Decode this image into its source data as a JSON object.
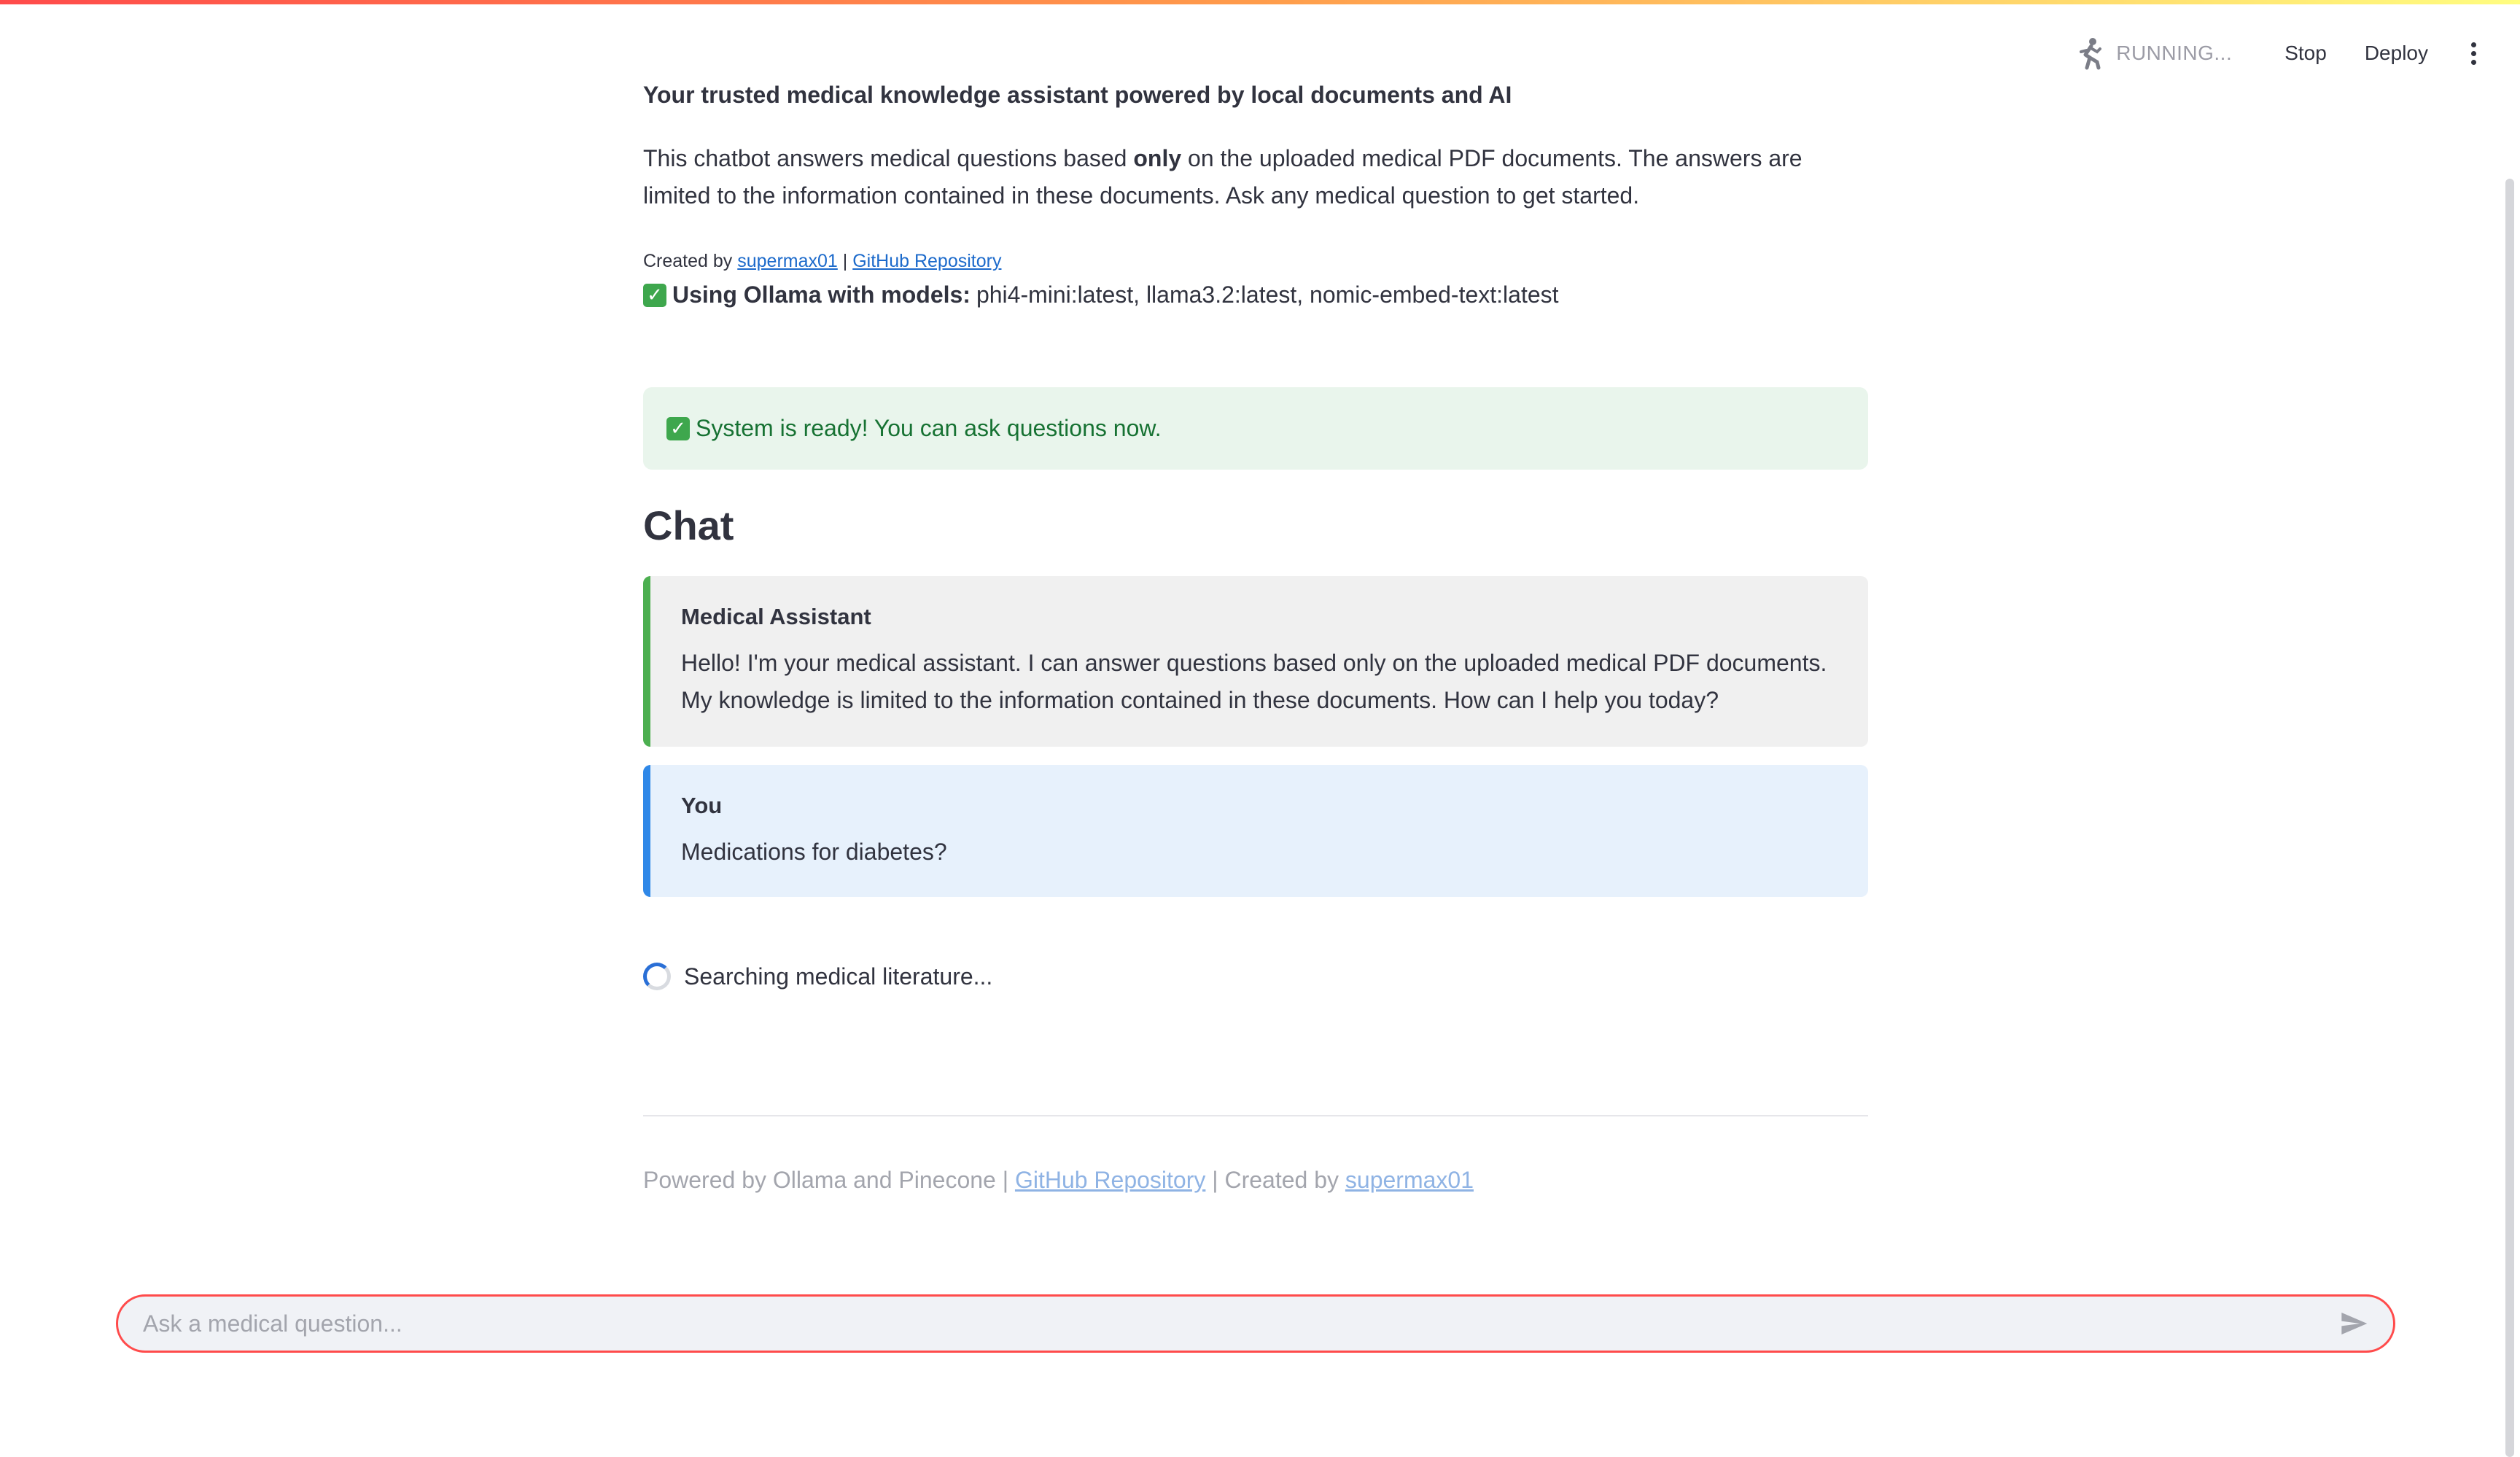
{
  "toolbar": {
    "status": "RUNNING...",
    "stop_label": "Stop",
    "deploy_label": "Deploy",
    "running_icon": "running-man-icon",
    "menu_icon": "kebab-menu-icon"
  },
  "header": {
    "tagline": "Your trusted medical knowledge assistant powered by local documents and AI",
    "intro_part1": "This chatbot answers medical questions based ",
    "intro_bold": "only",
    "intro_part2": " on the uploaded medical PDF documents. The answers are limited to the information contained in these documents. Ask any medical question to get started.",
    "credits_prefix": "Created by ",
    "credits_author": "supermax01",
    "credits_separator": " | ",
    "credits_repo": "GitHub Repository",
    "models_label": "Using Ollama with models:",
    "models_value": "phi4-mini:latest, llama3.2:latest, nomic-embed-text:latest"
  },
  "status_alert": {
    "text": "System is ready! You can ask questions now."
  },
  "chat": {
    "heading": "Chat",
    "messages": [
      {
        "author": "Medical Assistant",
        "text": "Hello! I'm your medical assistant. I can answer questions based only on the uploaded medical PDF documents. My knowledge is limited to the information contained in these documents. How can I help you today?"
      },
      {
        "author": "You",
        "text": "Medications for diabetes?"
      }
    ],
    "spinner_text": "Searching medical literature..."
  },
  "footer": {
    "prefix": "Powered by Ollama and Pinecone | ",
    "repo_link": "GitHub Repository",
    "middle": " | Created by ",
    "author_link": "supermax01"
  },
  "input": {
    "placeholder": "Ask a medical question...",
    "send_icon": "send-icon"
  },
  "colors": {
    "accent": "#ff4b4b",
    "assistant_border": "#4caf50",
    "user_border": "#2f88e8",
    "success_bg": "#e9f5ec",
    "success_text": "#177233"
  }
}
